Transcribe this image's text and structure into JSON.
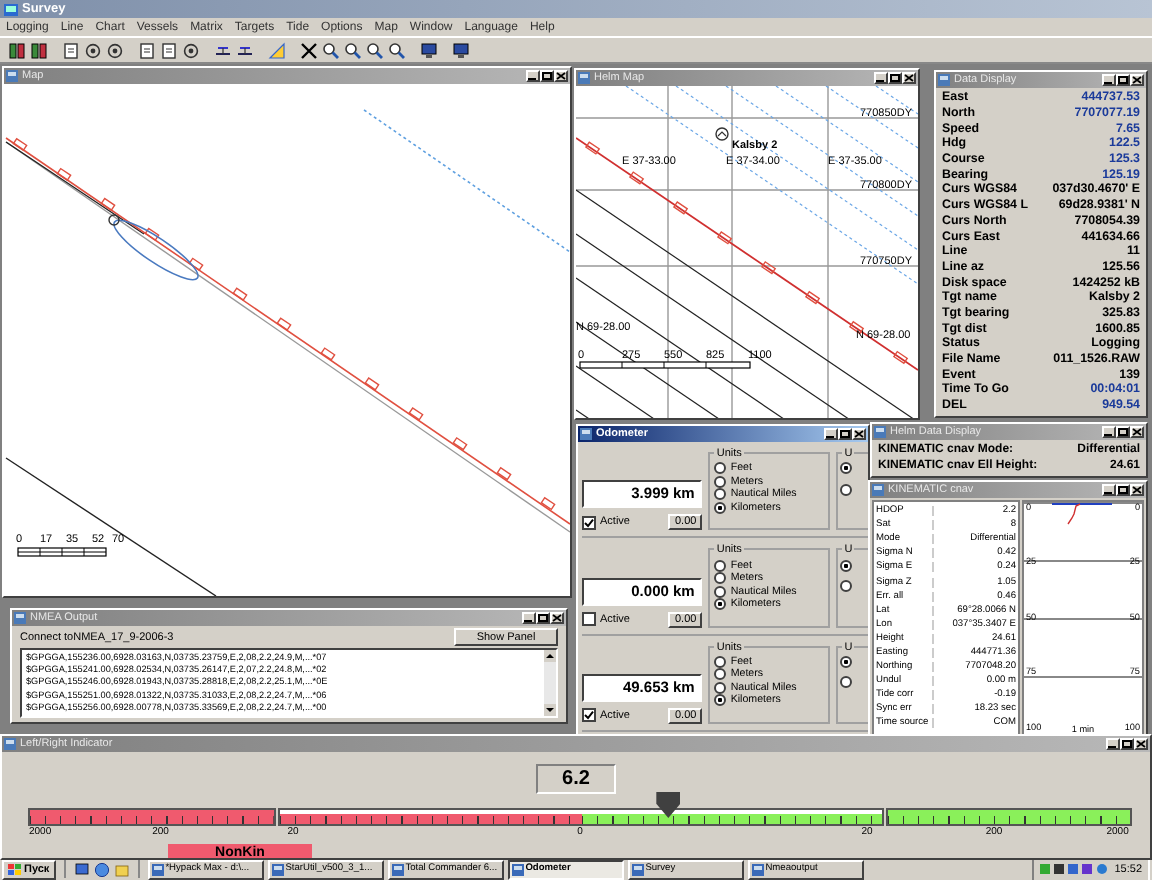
{
  "app": {
    "title": "Survey"
  },
  "menu": [
    "Logging",
    "Line",
    "Chart",
    "Vessels",
    "Matrix",
    "Targets",
    "Tide",
    "Options",
    "Map",
    "Window",
    "Language",
    "Help"
  ],
  "windows": [
    {
      "kind": "map",
      "title": "Map",
      "active": false,
      "scale_labels": [
        "0",
        "17",
        "35",
        "52",
        "70"
      ]
    },
    {
      "kind": "helm_map",
      "title": "Helm Map",
      "active": false,
      "target": "Kalsby 2",
      "northing_labels": [
        "770850DY",
        "770800DY",
        "770750DY"
      ],
      "easting_labels": [
        "E 37-33.00",
        "E 37-34.00",
        "E 37-35.00"
      ],
      "latitude_labels": [
        "N 69-28.00",
        "N 69-28.00"
      ],
      "scale_labels": [
        "0",
        "275",
        "550",
        "825",
        "1100"
      ]
    },
    {
      "kind": "data_display",
      "title": "Data Display",
      "active": false,
      "rows": [
        {
          "label": "East",
          "value": "444737.53",
          "color": "#1a3a9a"
        },
        {
          "label": "North",
          "value": "7707077.19",
          "color": "#1a3a9a"
        },
        {
          "label": "Speed",
          "value": "7.65",
          "color": "#1a3a9a"
        },
        {
          "label": "Hdg",
          "value": "122.5",
          "color": "#1a3a9a"
        },
        {
          "label": "Course",
          "value": "125.3",
          "color": "#1a3a9a"
        },
        {
          "label": "Bearing",
          "value": "125.19",
          "color": "#1a3a9a"
        },
        {
          "label": "Curs WGS84",
          "value": "037d30.4670' E",
          "color": "#000000"
        },
        {
          "label": "Curs WGS84 L",
          "value": "69d28.9381' N",
          "color": "#000000"
        },
        {
          "label": "Curs North",
          "value": "7708054.39",
          "color": "#000000"
        },
        {
          "label": "Curs East",
          "value": "441634.66",
          "color": "#000000"
        },
        {
          "label": "Line",
          "value": "11",
          "color": "#000000"
        },
        {
          "label": "Line az",
          "value": "125.56",
          "color": "#000000"
        },
        {
          "label": "Disk space",
          "value": "1424252 kB",
          "color": "#000000"
        },
        {
          "label": "Tgt name",
          "value": "Kalsby 2",
          "color": "#000000"
        },
        {
          "label": "Tgt bearing",
          "value": "325.83",
          "color": "#000000"
        },
        {
          "label": "Tgt dist",
          "value": "1600.85",
          "color": "#000000"
        },
        {
          "label": "Status",
          "value": "Logging",
          "color": "#000000"
        },
        {
          "label": "File Name",
          "value": "011_1526.RAW",
          "color": "#000000"
        },
        {
          "label": "Event",
          "value": "139",
          "color": "#000000"
        },
        {
          "label": "Time To Go",
          "value": "00:04:01",
          "color": "#1a3a9a"
        },
        {
          "label": "DEL",
          "value": "949.54",
          "color": "#1a3a9a"
        }
      ]
    },
    {
      "kind": "nmea",
      "title": "NMEA Output",
      "active": false,
      "connection": "Connect toNMEA_17_9-2006-3",
      "button": "Show Panel",
      "lines": [
        "$GPGGA,155236.00,6928.03163,N,03735.23759,E,2,08,2.2,24.9,M,...*07",
        "$GPGGA,155241.00,6928.02534,N,03735.26147,E,2,07,2.2,24.8,M,...*02",
        "$GPGGA,155246.00,6928.01943,N,03735.28818,E,2,08,2.2,25.1,M,...*0E",
        "$GPGGA,155251.00,6928.01322,N,03735.31033,E,2,08,2.2,24.7,M,...*06",
        "$GPGGA,155256.00,6928.00778,N,03735.33569,E,2,08,2.2,24.7,M,...*00"
      ]
    },
    {
      "kind": "odometer",
      "title": "Odometer",
      "active": true,
      "counters": [
        {
          "value": "3.999 km",
          "active": true,
          "active_label": "Active",
          "reset": "0.00",
          "units_label": "Units",
          "units": [
            {
              "label": "Feet",
              "selected": false
            },
            {
              "label": "Meters",
              "selected": false
            },
            {
              "label": "Nautical Miles",
              "selected": false
            },
            {
              "label": "Kilometers",
              "selected": true
            }
          ],
          "extra_label": "U",
          "extra_options": [
            {
              "selected": true
            },
            {
              "selected": false
            }
          ]
        },
        {
          "value": "0.000 km",
          "active": false,
          "active_label": "Active",
          "reset": "0.00",
          "units_label": "Units",
          "units": [
            {
              "label": "Feet",
              "selected": false
            },
            {
              "label": "Meters",
              "selected": false
            },
            {
              "label": "Nautical Miles",
              "selected": false
            },
            {
              "label": "Kilometers",
              "selected": true
            }
          ],
          "extra_label": "U",
          "extra_options": [
            {
              "selected": true
            },
            {
              "selected": false
            }
          ]
        },
        {
          "value": "49.653 km",
          "active": true,
          "active_label": "Active",
          "reset": "0.00",
          "units_label": "Units",
          "units": [
            {
              "label": "Feet",
              "selected": false
            },
            {
              "label": "Meters",
              "selected": false
            },
            {
              "label": "Nautical Miles",
              "selected": false
            },
            {
              "label": "Kilometers",
              "selected": true
            }
          ],
          "extra_label": "U",
          "extra_options": [
            {
              "selected": true
            },
            {
              "selected": false
            }
          ]
        }
      ]
    },
    {
      "kind": "helm_data",
      "title": "Helm Data Display",
      "active": false,
      "rows": [
        {
          "label": "KINEMATIC cnav Mode:",
          "value": "Differential"
        },
        {
          "label": "KINEMATIC cnav Ell Height:",
          "value": "24.61"
        }
      ]
    },
    {
      "kind": "kinematic",
      "title": "KINEMATIC cnav",
      "active": false,
      "rows": [
        {
          "label": "HDOP",
          "value": "2.2"
        },
        {
          "label": "Sat",
          "value": "8"
        },
        {
          "label": "Mode",
          "value": "Differential"
        },
        {
          "label": "Sigma N",
          "value": "0.42"
        },
        {
          "label": "Sigma E",
          "value": "0.24"
        },
        {
          "label": "Sigma Z",
          "value": "1.05"
        },
        {
          "label": "Err. all",
          "value": "0.46"
        },
        {
          "label": "Lat",
          "value": "69°28.0066 N"
        },
        {
          "label": "Lon",
          "value": "037°35.3407 E"
        },
        {
          "label": "Height",
          "value": "24.61"
        },
        {
          "label": "Easting",
          "value": "444771.36"
        },
        {
          "label": "Northing",
          "value": "7707048.20"
        },
        {
          "label": "Undul",
          "value": "0.00 m"
        },
        {
          "label": "Tide corr",
          "value": "-0.19"
        },
        {
          "label": "Sync err",
          "value": "18.23 sec"
        },
        {
          "label": "Time source",
          "value": "COM"
        }
      ],
      "left_ticks": [
        "0",
        "25",
        "50",
        "75",
        "100"
      ],
      "right_ticks": [
        "0",
        "25",
        "50",
        "75",
        "100"
      ],
      "xlabel": "1 min"
    },
    {
      "kind": "indicator",
      "title": "Left/Right Indicator",
      "active": false,
      "value": "6.2",
      "scale_labels": [
        "2000",
        "200",
        "20",
        "0",
        "20",
        "200",
        "2000"
      ],
      "level": 0.58,
      "mode": "NonKin"
    }
  ],
  "taskbar": {
    "start": "Пуск",
    "tasks": [
      {
        "label": "*Hypack Max - d:\\...",
        "selected": false
      },
      {
        "label": "StarUtil_v500_3_1...",
        "selected": false
      },
      {
        "label": "Total Commander 6...",
        "selected": false
      },
      {
        "label": "Odometer",
        "selected": true
      },
      {
        "label": "Survey",
        "selected": false
      },
      {
        "label": "Nmeaoutput",
        "selected": false
      }
    ],
    "clock": "15:52"
  }
}
